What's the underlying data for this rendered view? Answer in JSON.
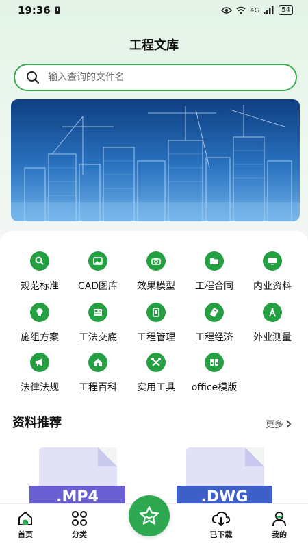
{
  "status_bar": {
    "time": "19:36",
    "network": "4G",
    "battery": "54"
  },
  "header": {
    "title": "工程文库"
  },
  "search": {
    "placeholder": "输入查询的文件名"
  },
  "banner": {
    "icon": "city-blueprint-image"
  },
  "categories": [
    {
      "label": "规范标准",
      "icon": "magnifier-icon"
    },
    {
      "label": "CAD图库",
      "icon": "picture-icon"
    },
    {
      "label": "效果模型",
      "icon": "camera-icon"
    },
    {
      "label": "工程合同",
      "icon": "folder-icon"
    },
    {
      "label": "内业资料",
      "icon": "monitor-icon"
    },
    {
      "label": "施组方案",
      "icon": "lightbulb-icon"
    },
    {
      "label": "工法交底",
      "icon": "image-card-icon"
    },
    {
      "label": "工程管理",
      "icon": "phone-card-icon"
    },
    {
      "label": "工程经济",
      "icon": "usb-icon"
    },
    {
      "label": "外业测量",
      "icon": "compass-icon"
    },
    {
      "label": "法律法规",
      "icon": "megaphone-icon"
    },
    {
      "label": "工程百科",
      "icon": "house-icon"
    },
    {
      "label": "实用工具",
      "icon": "tools-icon"
    },
    {
      "label": "office模版",
      "icon": "speaker-icon"
    }
  ],
  "recommend": {
    "title": "资料推荐",
    "more_label": "更多",
    "items": [
      {
        "tag": ".MP4",
        "color": "#6a5fd0"
      },
      {
        "tag": ".DWG",
        "color": "#3f5fc8"
      }
    ]
  },
  "tab_bar": {
    "items": [
      {
        "label": "首页",
        "icon": "home-icon"
      },
      {
        "label": "分类",
        "icon": "grid-icon"
      },
      {
        "label": "",
        "icon": "star-icon"
      },
      {
        "label": "已下载",
        "icon": "cloud-download-icon"
      },
      {
        "label": "我的",
        "icon": "user-icon"
      }
    ]
  },
  "colors": {
    "accent": "#2ea850",
    "icon_green": "#24a043"
  }
}
